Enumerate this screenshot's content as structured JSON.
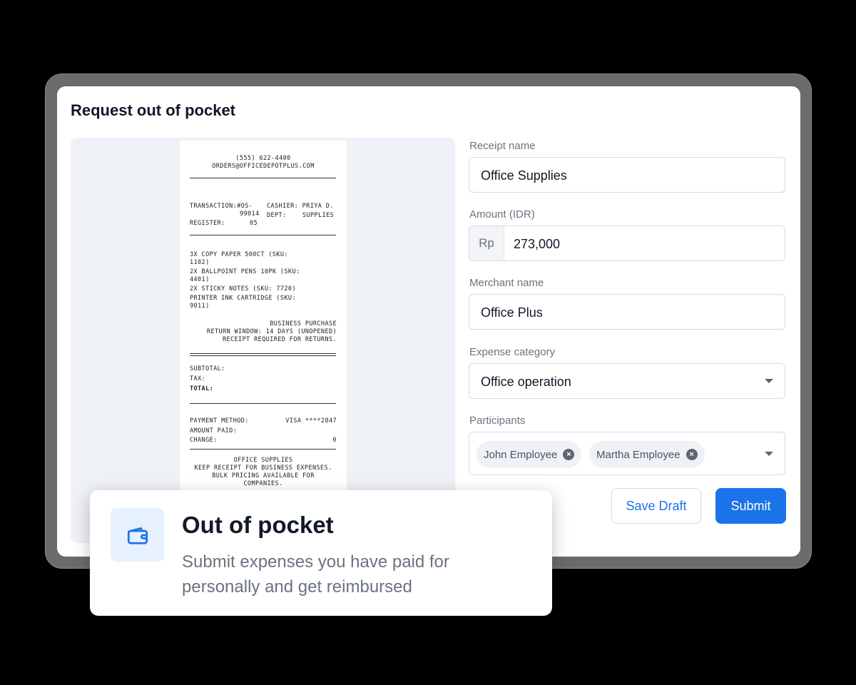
{
  "page": {
    "title": "Request out of pocket"
  },
  "receipt": {
    "phone": "(555) 622-4400",
    "email": "ORDERS@OFFICEDEPOTPLUS.COM",
    "transaction_label": "TRANSACTION:#OS-",
    "transaction_no": "99014",
    "cashier": "CASHIER: PRIYA D.",
    "dept": "DEPT:",
    "dept_value": "SUPPLIES",
    "register_label": "REGISTER:",
    "register_no": "05",
    "items": [
      "3X COPY PAPER 500CT (SKU:",
      "1102)",
      "2X BALLPOINT PENS 10PK (SKU:",
      "4401)",
      "2X STICKY NOTES (SKU: 7720)",
      "PRINTER INK CARTRIDGE (SKU:",
      "9011)"
    ],
    "note1": "BUSINESS PURCHASE",
    "note2": "RETURN WINDOW: 14 DAYS (UNOPENED)",
    "note3": "RECEIPT REQUIRED FOR RETURNS.",
    "subtotal": "SUBTOTAL:",
    "tax": "TAX:",
    "total": "TOTAL:",
    "payment_method_label": "PAYMENT METHOD:",
    "payment_method": "VISA ****2847",
    "amount_paid": "AMOUNT PAID:",
    "change_label": "CHANGE:",
    "change_value": "0",
    "footer1": "OFFICE SUPPLIES",
    "footer2": "KEEP RECEIPT FOR BUSINESS EXPENSES.",
    "footer3": "BULK PRICING AVAILABLE FOR",
    "footer4": "COMPANIES."
  },
  "form": {
    "receipt_name": {
      "label": "Receipt name",
      "value": "Office Supplies"
    },
    "amount": {
      "label": "Amount (IDR)",
      "prefix": "Rp",
      "value": "273,000"
    },
    "merchant": {
      "label": "Merchant name",
      "value": "Office Plus"
    },
    "category": {
      "label": "Expense category",
      "value": "Office operation"
    },
    "participants": {
      "label": "Participants",
      "chips": [
        "John Employee",
        "Martha Employee"
      ]
    },
    "save_draft": "Save Draft",
    "submit": "Submit"
  },
  "card": {
    "icon": "wallet-icon",
    "title": "Out of pocket",
    "description": "Submit expenses you have paid for personally and get reimbursed"
  },
  "colors": {
    "accent": "#1a73e8",
    "background": "#000000"
  }
}
